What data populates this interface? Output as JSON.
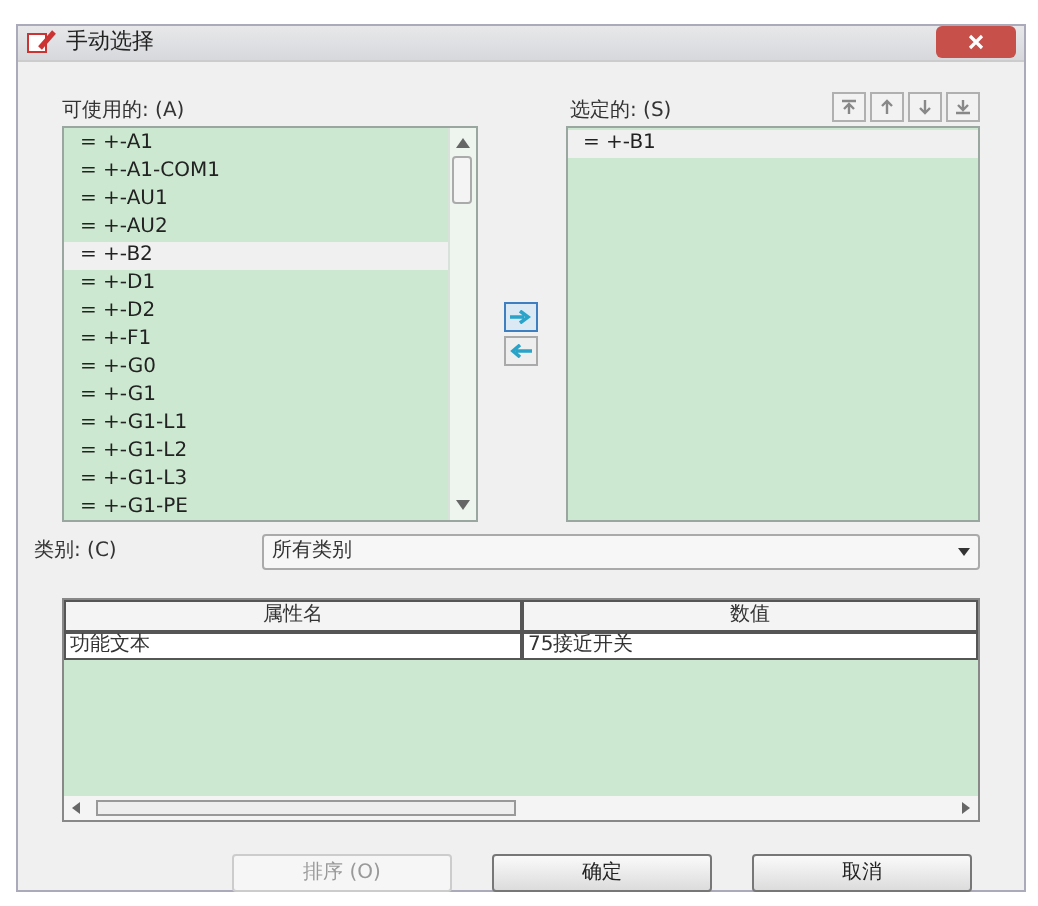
{
  "window": {
    "title": "手动选择"
  },
  "available": {
    "label": "可使用的: (A)",
    "items": [
      {
        "text": "= +-A1",
        "selected": false
      },
      {
        "text": "= +-A1-COM1",
        "selected": false
      },
      {
        "text": "= +-AU1",
        "selected": false
      },
      {
        "text": "= +-AU2",
        "selected": false
      },
      {
        "text": "= +-B2",
        "selected": true
      },
      {
        "text": "= +-D1",
        "selected": false
      },
      {
        "text": "= +-D2",
        "selected": false
      },
      {
        "text": "= +-F1",
        "selected": false
      },
      {
        "text": "= +-G0",
        "selected": false
      },
      {
        "text": "= +-G1",
        "selected": false
      },
      {
        "text": "= +-G1-L1",
        "selected": false
      },
      {
        "text": "= +-G1-L2",
        "selected": false
      },
      {
        "text": "= +-G1-L3",
        "selected": false
      },
      {
        "text": "= +-G1-PE",
        "selected": false
      }
    ]
  },
  "chosen": {
    "label": "选定的: (S)",
    "items": [
      {
        "text": "= +-B1",
        "selected": true
      }
    ]
  },
  "category": {
    "label": "类别: (C)",
    "value": "所有类别"
  },
  "table": {
    "columns": [
      "属性名",
      "数值"
    ],
    "rows": [
      [
        "功能文本",
        "75接近开关"
      ]
    ]
  },
  "buttons": [
    {
      "label": "排序 (O)",
      "disabled": true
    },
    {
      "label": "确定",
      "disabled": false
    },
    {
      "label": "取消",
      "disabled": false
    }
  ]
}
